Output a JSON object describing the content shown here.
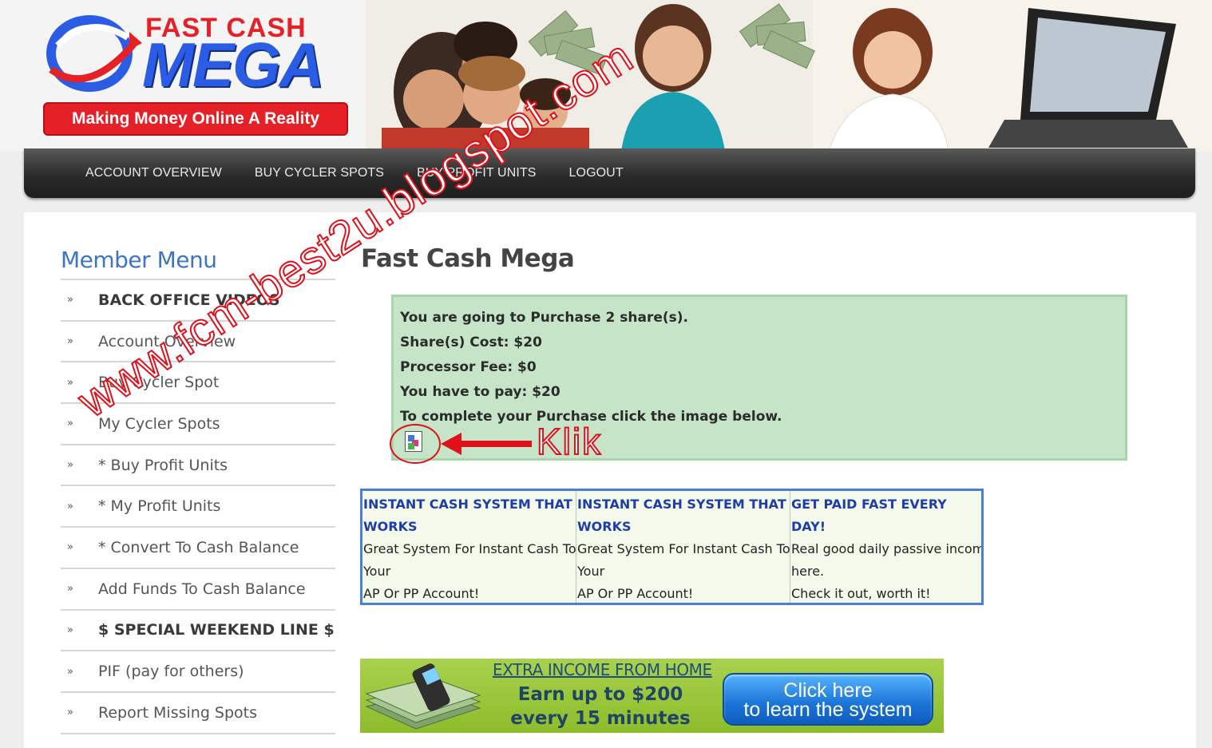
{
  "brand": {
    "line1": "FAST CASH",
    "line2": "MEGA",
    "tagline": "Making Money Online A Reality",
    "colors": {
      "red": "#e52026",
      "blue": "#2b5ce6"
    }
  },
  "nav": {
    "items": [
      "ACCOUNT OVERVIEW",
      "BUY CYCLER SPOTS",
      "BUY PROFIT UNITS",
      "LOGOUT"
    ]
  },
  "sidebar": {
    "title": "Member Menu",
    "bullet_icon": "double-chevron-icon",
    "items": [
      {
        "label": "BACK OFFICE VIDEOS",
        "bold": true
      },
      {
        "label": "Account Overview",
        "bold": false
      },
      {
        "label": "Buy Cycler Spot",
        "bold": false
      },
      {
        "label": "My Cycler Spots",
        "bold": false
      },
      {
        "label": "* Buy Profit Units",
        "bold": false
      },
      {
        "label": "* My Profit Units",
        "bold": false
      },
      {
        "label": "* Convert To Cash Balance",
        "bold": false
      },
      {
        "label": "Add Funds To Cash Balance",
        "bold": false
      },
      {
        "label": "$ SPECIAL WEEKEND LINE $",
        "bold": true
      },
      {
        "label": "PIF (pay for others)",
        "bold": false
      },
      {
        "label": "Report Missing Spots",
        "bold": false
      }
    ]
  },
  "main": {
    "title": "Fast Cash Mega",
    "purchase": {
      "line1": "You are going to Purchase 2 share(s).",
      "line2": "Share(s) Cost: $20",
      "line3": "Processor Fee: $0",
      "line4": "You have to pay: $20",
      "line5": "To complete your Purchase click the image below."
    },
    "ads": [
      {
        "title": "INSTANT CASH SYSTEM THAT WORKS",
        "lines": [
          "Great System For Instant Cash To",
          "Your",
          "AP Or PP Account!"
        ]
      },
      {
        "title": "INSTANT CASH SYSTEM THAT WORKS",
        "lines": [
          "Great System For Instant Cash To",
          "Your",
          "AP Or PP Account!"
        ]
      },
      {
        "title": "GET PAID FAST EVERY DAY!",
        "lines": [
          "Real good daily passive income",
          "here.",
          "Check it out, worth it!"
        ]
      }
    ],
    "promo": {
      "headline": "EXTRA INCOME FROM HOME",
      "line1": "Earn up to $200",
      "line2": "every 15 minutes",
      "button_line1": "Click here",
      "button_line2": "to learn the system"
    }
  },
  "overlay": {
    "watermark": "www.fcm-best2u.blogspot.com",
    "klik": "Klik",
    "color": "#e0101a"
  }
}
